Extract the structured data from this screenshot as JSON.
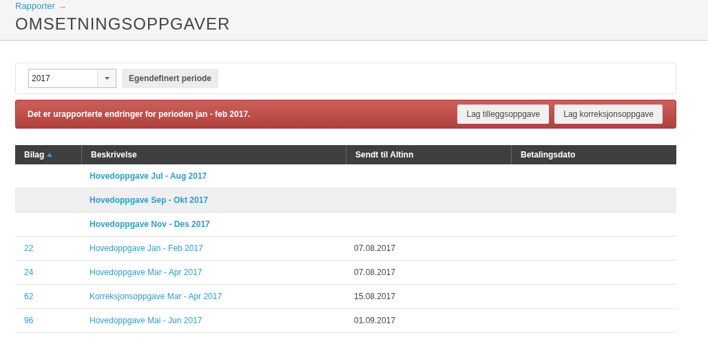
{
  "breadcrumb": {
    "label": "Rapporter",
    "arrow": "→"
  },
  "title": "OMSETNINGSOPPGAVER",
  "filter": {
    "year": "2017",
    "custom_period_button": "Egendefinert periode"
  },
  "alert": {
    "message": "Det er urapporterte endringer for perioden jan - feb 2017.",
    "buttons": [
      "Lag tilleggsoppgave",
      "Lag korreksjonsoppgave"
    ]
  },
  "table": {
    "columns": [
      {
        "label": "Bilag",
        "sorted": true
      },
      {
        "label": "Beskrivelse",
        "sorted": false
      },
      {
        "label": "Sendt til Altinn",
        "sorted": false
      },
      {
        "label": "Betalingsdato",
        "sorted": false
      }
    ],
    "rows": [
      {
        "bilag": "",
        "description": "Hovedoppgave Jul - Aug 2017",
        "sent": "",
        "unsent": true,
        "selected": false
      },
      {
        "bilag": "",
        "description": "Hovedoppgave Sep - Okt 2017",
        "sent": "",
        "unsent": true,
        "selected": true
      },
      {
        "bilag": "",
        "description": "Hovedoppgave Nov - Des 2017",
        "sent": "",
        "unsent": true,
        "selected": false
      },
      {
        "bilag": "22",
        "description": "Hovedoppgave Jan - Feb 2017",
        "sent": "07.08.2017",
        "unsent": false,
        "selected": false
      },
      {
        "bilag": "24",
        "description": "Hovedoppgave Mar - Apr 2017",
        "sent": "07.08.2017",
        "unsent": false,
        "selected": false
      },
      {
        "bilag": "62",
        "description": "Korreksjonsoppgave Mar - Apr 2017",
        "sent": "15.08.2017",
        "unsent": false,
        "selected": false
      },
      {
        "bilag": "96",
        "description": "Hovedoppgave Mai - Jun 2017",
        "sent": "01.09.2017",
        "unsent": false,
        "selected": false
      }
    ]
  }
}
